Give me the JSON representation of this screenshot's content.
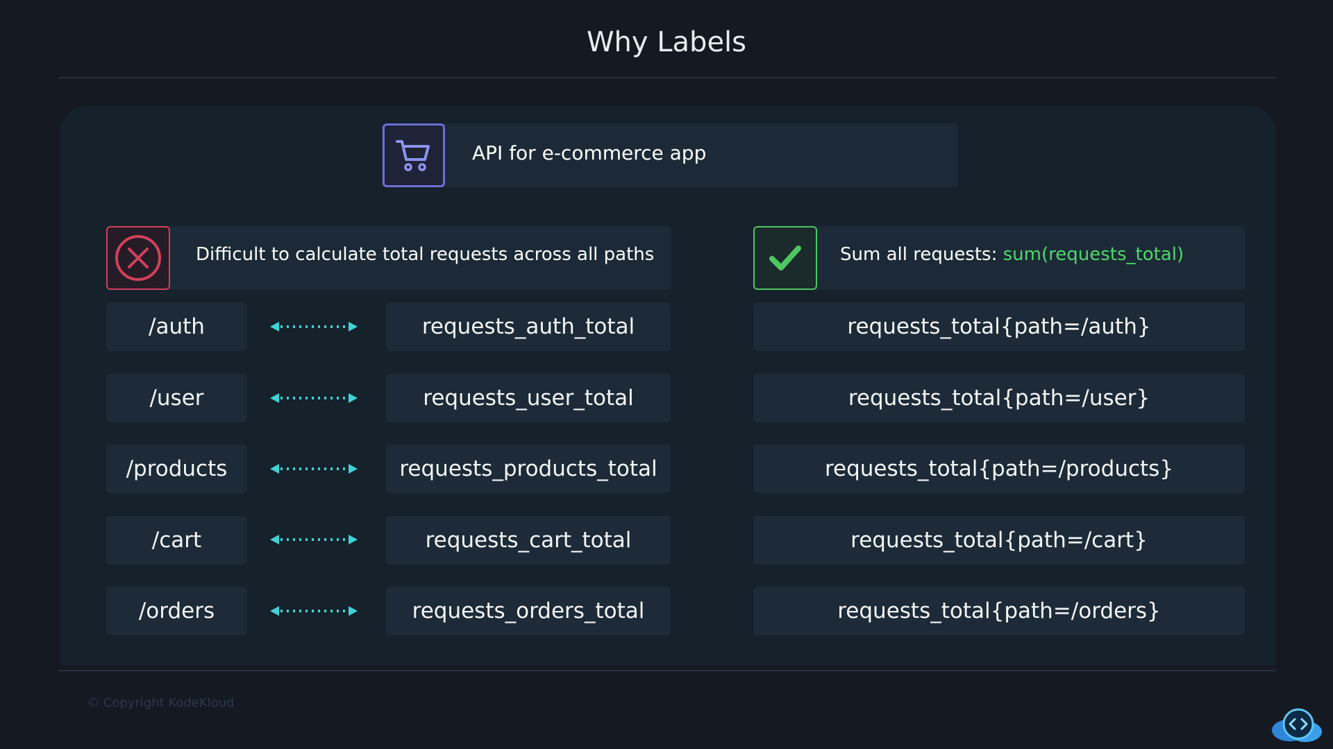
{
  "title": "Why Labels",
  "header": {
    "api_label": "API for e-commerce app",
    "api_icon": "shopping-cart-icon"
  },
  "bad": {
    "icon": "x-circle-icon",
    "label": "Difficult to calculate total requests across all paths"
  },
  "good": {
    "icon": "checkmark-icon",
    "label_prefix": "Sum all requests: ",
    "expression": "sum(requests_total)"
  },
  "rows": [
    {
      "path": "/auth",
      "metric": "requests_auth_total",
      "labeled": "requests_total{path=/auth}"
    },
    {
      "path": "/user",
      "metric": "requests_user_total",
      "labeled": "requests_total{path=/user}"
    },
    {
      "path": "/products",
      "metric": "requests_products_total",
      "labeled": "requests_total{path=/products}"
    },
    {
      "path": "/cart",
      "metric": "requests_cart_total",
      "labeled": "requests_total{path=/cart}"
    },
    {
      "path": "/orders",
      "metric": "requests_orders_total",
      "labeled": "requests_total{path=/orders}"
    }
  ],
  "footer": {
    "copyright": "© Copyright KodeKloud"
  },
  "colors": {
    "background": "#141922",
    "panel": "#15212b",
    "chip": "#1d2a37",
    "accent_red": "#d2405a",
    "accent_green": "#4ec760",
    "accent_indigo": "#6c6fd3",
    "arrow": "#3fd3d6"
  }
}
